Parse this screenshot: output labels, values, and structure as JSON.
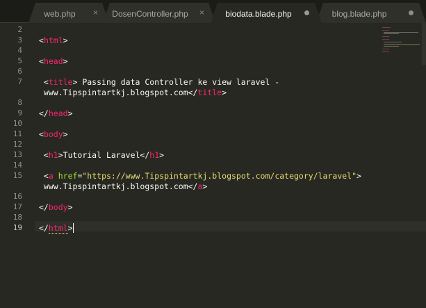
{
  "tabs": [
    {
      "label": "web.php",
      "active": false,
      "marker": "close",
      "marker_glyph": "×"
    },
    {
      "label": "DosenController.php",
      "active": false,
      "marker": "close",
      "marker_glyph": "×"
    },
    {
      "label": "biodata.blade.php",
      "active": true,
      "marker": "dirty",
      "marker_glyph": ""
    },
    {
      "label": "blog.blade.php",
      "active": false,
      "marker": "dirty",
      "marker_glyph": ""
    }
  ],
  "editor": {
    "current_line": "19",
    "lines": [
      {
        "num": "2",
        "tokens": []
      },
      {
        "num": "3",
        "tokens": [
          {
            "t": "<",
            "c": "plain"
          },
          {
            "t": "html",
            "c": "tag"
          },
          {
            "t": ">",
            "c": "plain"
          }
        ]
      },
      {
        "num": "4",
        "tokens": []
      },
      {
        "num": "5",
        "tokens": [
          {
            "t": "<",
            "c": "plain"
          },
          {
            "t": "head",
            "c": "tag"
          },
          {
            "t": ">",
            "c": "plain"
          }
        ]
      },
      {
        "num": "6",
        "tokens": []
      },
      {
        "num": "7",
        "tokens": [
          {
            "t": " <",
            "c": "plain"
          },
          {
            "t": "title",
            "c": "tag"
          },
          {
            "t": "> Passing data Controller ke view laravel -",
            "c": "plain"
          }
        ]
      },
      {
        "num": "",
        "tokens": [
          {
            "t": " www.Tipspintartkj.blogspot.com</",
            "c": "plain"
          },
          {
            "t": "title",
            "c": "tag"
          },
          {
            "t": ">",
            "c": "plain"
          }
        ]
      },
      {
        "num": "8",
        "tokens": []
      },
      {
        "num": "9",
        "tokens": [
          {
            "t": "</",
            "c": "plain"
          },
          {
            "t": "head",
            "c": "tag"
          },
          {
            "t": ">",
            "c": "plain"
          }
        ]
      },
      {
        "num": "10",
        "tokens": []
      },
      {
        "num": "11",
        "tokens": [
          {
            "t": "<",
            "c": "plain"
          },
          {
            "t": "body",
            "c": "tag"
          },
          {
            "t": ">",
            "c": "plain"
          }
        ]
      },
      {
        "num": "12",
        "tokens": []
      },
      {
        "num": "13",
        "tokens": [
          {
            "t": " <",
            "c": "plain"
          },
          {
            "t": "h1",
            "c": "tag"
          },
          {
            "t": ">Tutorial Laravel</",
            "c": "plain"
          },
          {
            "t": "h1",
            "c": "tag"
          },
          {
            "t": ">",
            "c": "plain"
          }
        ]
      },
      {
        "num": "14",
        "tokens": []
      },
      {
        "num": "15",
        "tokens": [
          {
            "t": " <",
            "c": "plain"
          },
          {
            "t": "a",
            "c": "tag"
          },
          {
            "t": " ",
            "c": "plain"
          },
          {
            "t": "href",
            "c": "attr"
          },
          {
            "t": "=",
            "c": "plain"
          },
          {
            "t": "\"https://www.Tipspintartkj.blogspot.com/category/laravel\"",
            "c": "str"
          },
          {
            "t": ">",
            "c": "plain"
          }
        ]
      },
      {
        "num": "",
        "tokens": [
          {
            "t": " www.Tipspintartkj.blogspot.com</",
            "c": "plain"
          },
          {
            "t": "a",
            "c": "tag"
          },
          {
            "t": ">",
            "c": "plain"
          }
        ]
      },
      {
        "num": "16",
        "tokens": []
      },
      {
        "num": "17",
        "tokens": [
          {
            "t": "</",
            "c": "plain"
          },
          {
            "t": "body",
            "c": "tag"
          },
          {
            "t": ">",
            "c": "plain"
          }
        ]
      },
      {
        "num": "18",
        "tokens": []
      },
      {
        "num": "19",
        "tokens": [
          {
            "t": "</",
            "c": "plain"
          },
          {
            "t": "html",
            "c": "tag",
            "u": true
          },
          {
            "t": ">",
            "c": "plain"
          }
        ],
        "caret": true
      }
    ]
  },
  "colors": {
    "background": "#272822",
    "tag": "#f92672",
    "attribute": "#a6e22e",
    "string": "#e6db74",
    "text": "#f8f8f2",
    "line_number": "#8f908a"
  }
}
